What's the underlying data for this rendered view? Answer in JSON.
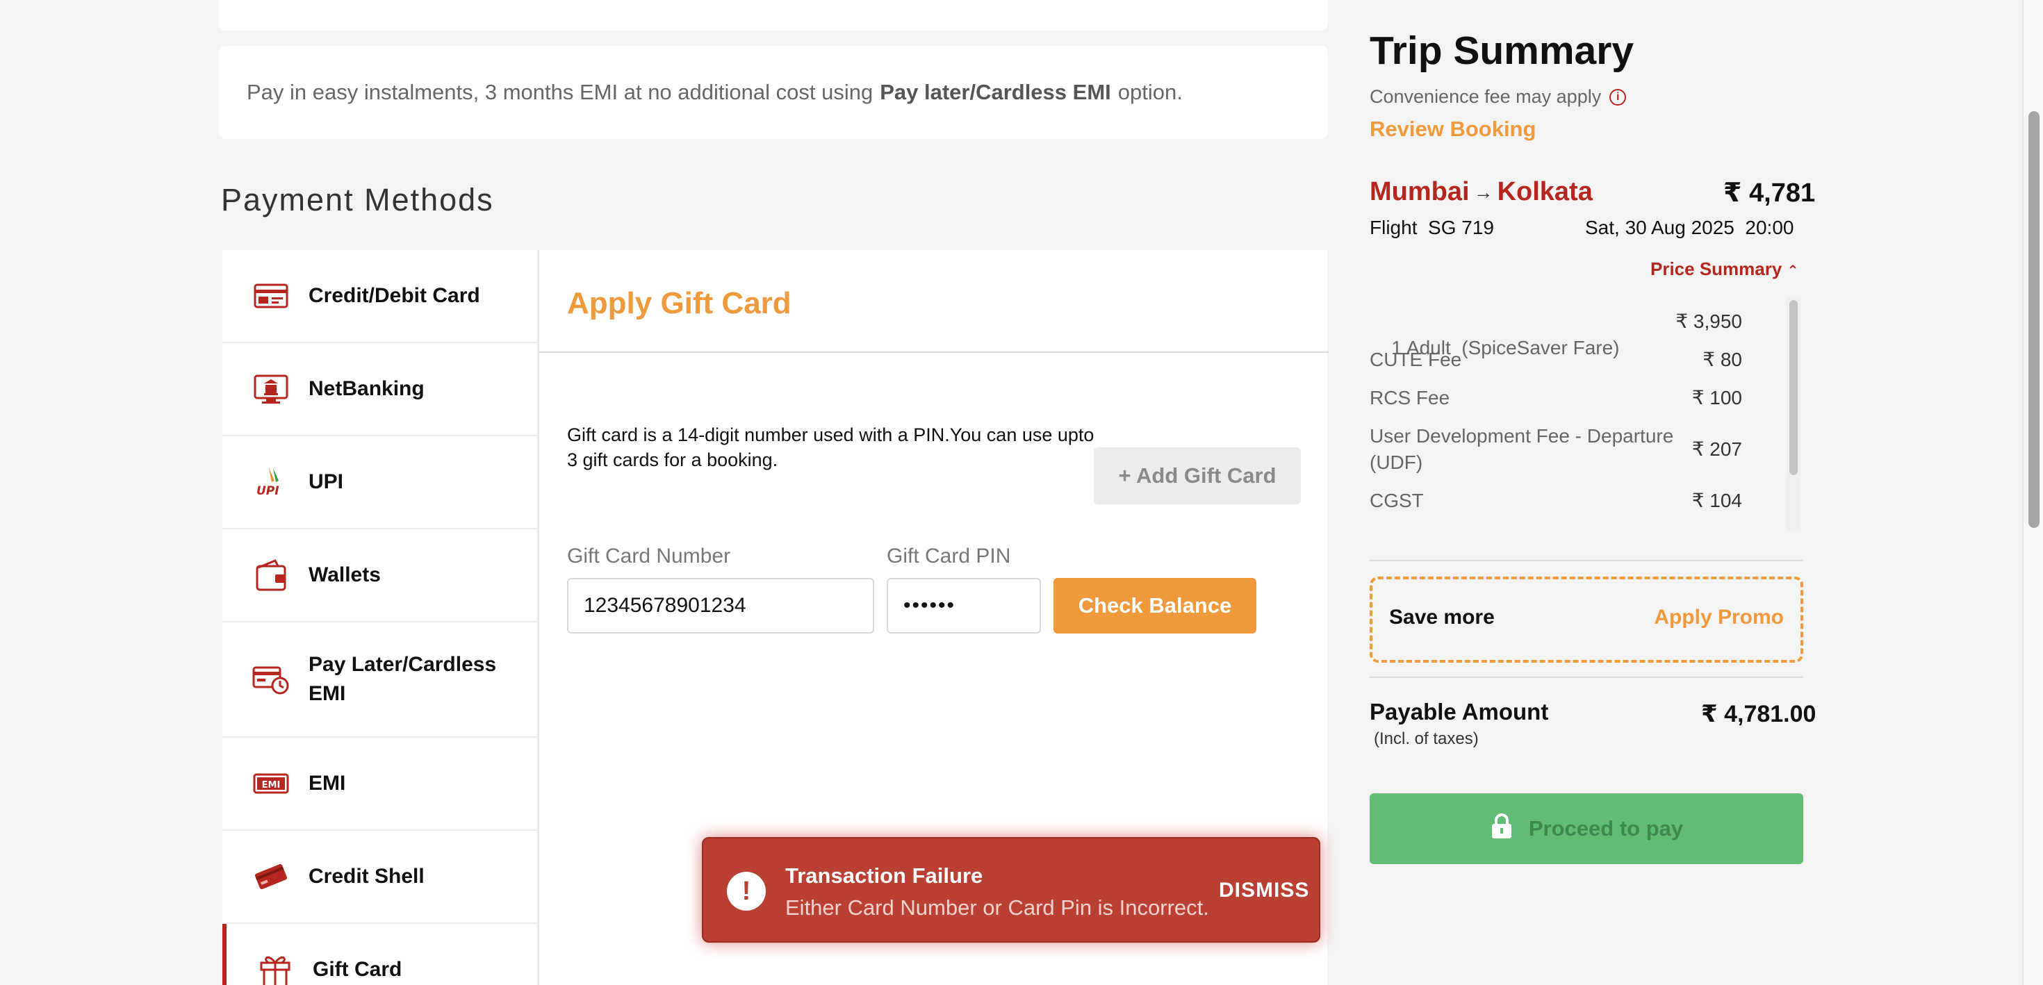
{
  "emi_banner": {
    "text_before": "Pay in easy instalments, 3 months EMI at no additional cost using",
    "highlight": "Pay later/Cardless EMI",
    "text_after": "option."
  },
  "payment_methods": {
    "title": "Payment Methods",
    "items": [
      {
        "label": "Credit/Debit Card",
        "icon": "credit-card-icon"
      },
      {
        "label": "NetBanking",
        "icon": "netbanking-icon"
      },
      {
        "label": "UPI",
        "icon": "upi-icon"
      },
      {
        "label": "Wallets",
        "icon": "wallet-icon"
      },
      {
        "label": "Pay Later/Cardless EMI",
        "icon": "pay-later-icon"
      },
      {
        "label": "EMI",
        "icon": "emi-icon"
      },
      {
        "label": "Credit Shell",
        "icon": "credit-shell-icon"
      },
      {
        "label": "Gift Card",
        "icon": "gift-icon",
        "active": true
      }
    ]
  },
  "gift_card": {
    "title": "Apply Gift Card",
    "description": "Gift card is a 14-digit number used with a PIN.You can use upto 3 gift cards for a booking.",
    "add_button": "+ Add Gift Card",
    "number_label": "Gift Card Number",
    "number_value": "12345678901234",
    "pin_label": "Gift Card PIN",
    "pin_value": "••••••",
    "check_button": "Check Balance"
  },
  "toast": {
    "title": "Transaction Failure",
    "message": "Either Card Number or Card Pin is Incorrect.",
    "dismiss": "DISMISS"
  },
  "summary": {
    "title": "Trip Summary",
    "convenience": "Convenience fee may apply",
    "review": "Review Booking",
    "origin": "Mumbai",
    "destination": "Kolkata",
    "total": "₹ 4,781",
    "flight": "Flight  SG 719",
    "date": "Sat, 30 Aug 2025  20:00",
    "price_summary_link": "Price Summary",
    "fare_items": [
      {
        "label": "1 Adult  (SpiceSaver Fare)",
        "amount": "₹ 3,950"
      },
      {
        "label": "CUTE Fee",
        "amount": "₹ 80"
      },
      {
        "label": "RCS Fee",
        "amount": "₹ 100"
      },
      {
        "label": "User Development Fee - Departure (UDF)",
        "amount": "₹ 207"
      },
      {
        "label": "CGST",
        "amount": "₹ 104"
      }
    ],
    "promo_left": "Save more",
    "promo_right": "Apply Promo",
    "payable_label": "Payable Amount",
    "payable_sub": "(Incl. of taxes)",
    "payable_amount": "₹ 4,781.00",
    "proceed": "Proceed to pay"
  },
  "colors": {
    "brand_red": "#b5261e",
    "accent_orange": "#ef9a3c",
    "proceed_green": "#61bc74",
    "toast_red": "#b94032"
  }
}
